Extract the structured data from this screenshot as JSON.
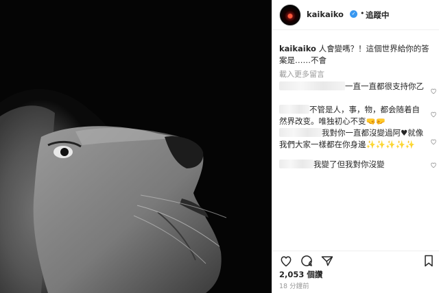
{
  "post": {
    "username": "kaikaiko",
    "follow_label": "追蹤中",
    "separator": "•"
  },
  "caption": {
    "username": "kaikaiko",
    "text": " 人會變嗎？！這個世界給你的答案是……不會"
  },
  "load_more": "載入更多留言",
  "comments": [
    {
      "text": "一直一直都很支持你乙"
    },
    {
      "text": "不管是人，事，物，都会随着自然界改变。唯独初心不变🤜🤛"
    },
    {
      "text": "我對你一直都沒變過阿♥就像我們大家一樣都在你身邊✨✨✨✨✨"
    },
    {
      "text": "我變了但我對你沒變"
    }
  ],
  "likes": "2,053 個讚",
  "timestamp": "18 分鐘前",
  "icons": {
    "like": "heart-outline-icon",
    "comment": "speech-bubble-icon",
    "share": "share-icon",
    "save": "bookmark-icon",
    "comment_like": "small-heart-icon",
    "verified": "verified-badge-icon"
  },
  "colors": {
    "verified_blue": "#3897f0",
    "photo_bg": "#050505"
  }
}
